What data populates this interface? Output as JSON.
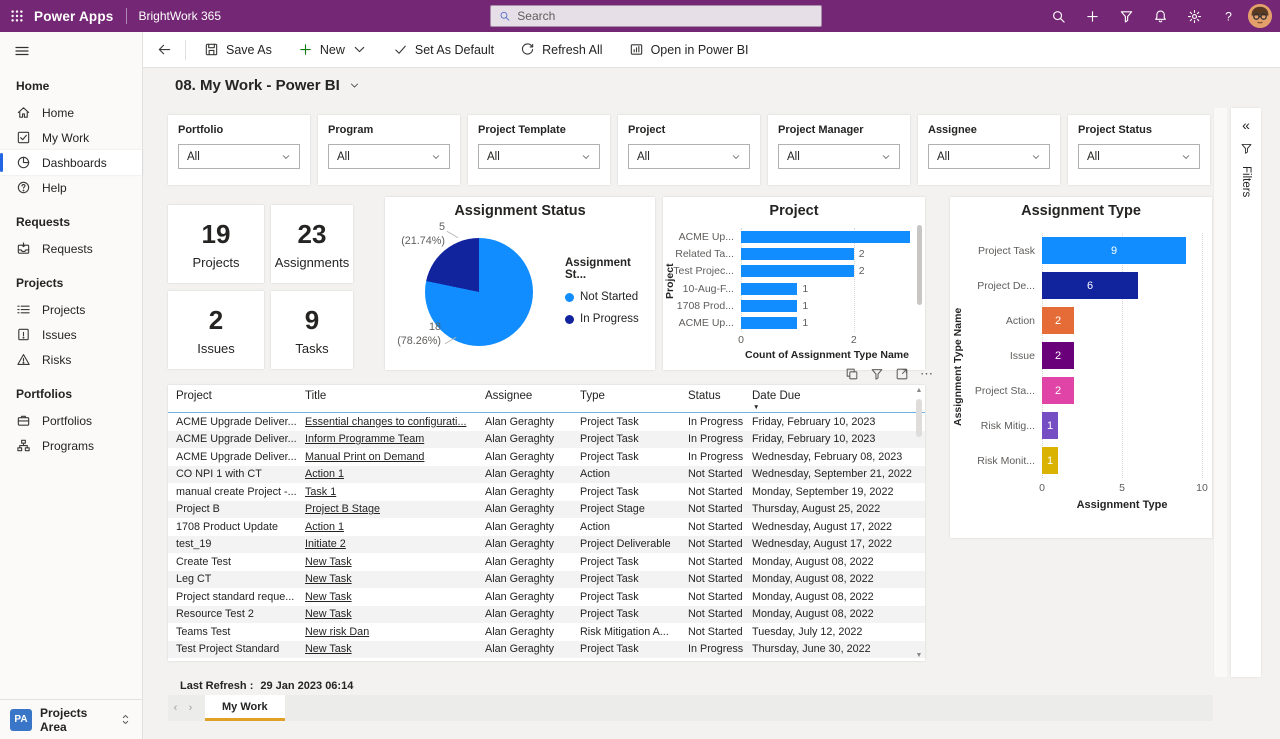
{
  "colors": {
    "header_purple": "#742774",
    "accent_blue": "#2266E3",
    "powerbi_blue": "#118DFF",
    "powerbi_navy": "#12239E",
    "tab_active_underline": "#DFA226",
    "table_header_underline": "#71AFE5"
  },
  "header": {
    "app_name": "Power Apps",
    "environment": "BrightWork 365",
    "search_placeholder": "Search",
    "icons": [
      "search",
      "add",
      "filter",
      "bell",
      "gear",
      "help"
    ]
  },
  "command_bar": {
    "items": [
      {
        "label": "Save As",
        "icon": "save",
        "dropdown": false
      },
      {
        "label": "New",
        "icon": "add-green",
        "dropdown": true
      },
      {
        "label": "Set As Default",
        "icon": "check",
        "dropdown": false
      },
      {
        "label": "Refresh All",
        "icon": "refresh",
        "dropdown": false
      },
      {
        "label": "Open in Power BI",
        "icon": "openbi",
        "dropdown": false
      }
    ]
  },
  "page": {
    "title": "08. My Work - Power BI"
  },
  "sidebar": {
    "sections": [
      {
        "heading": "Home",
        "items": [
          {
            "label": "Home",
            "icon": "home",
            "selected": false
          },
          {
            "label": "My Work",
            "icon": "mywork",
            "selected": false
          },
          {
            "label": "Dashboards",
            "icon": "dashboards",
            "selected": true
          },
          {
            "label": "Help",
            "icon": "helpdoc",
            "selected": false
          }
        ]
      },
      {
        "heading": "Requests",
        "items": [
          {
            "label": "Requests",
            "icon": "inbox",
            "selected": false
          }
        ]
      },
      {
        "heading": "Projects",
        "items": [
          {
            "label": "Projects",
            "icon": "projects",
            "selected": false
          },
          {
            "label": "Issues",
            "icon": "issues",
            "selected": false
          },
          {
            "label": "Risks",
            "icon": "risks",
            "selected": false
          }
        ]
      },
      {
        "heading": "Portfolios",
        "items": [
          {
            "label": "Portfolios",
            "icon": "briefcase",
            "selected": false
          },
          {
            "label": "Programs",
            "icon": "org",
            "selected": false
          }
        ]
      }
    ],
    "area_switcher": {
      "badge": "PA",
      "label": "Projects Area"
    }
  },
  "filters_pane": {
    "label": "Filters"
  },
  "slicers": [
    {
      "label": "Portfolio",
      "value": "All"
    },
    {
      "label": "Program",
      "value": "All"
    },
    {
      "label": "Project Template",
      "value": "All"
    },
    {
      "label": "Project",
      "value": "All"
    },
    {
      "label": "Project Manager",
      "value": "All"
    },
    {
      "label": "Assignee",
      "value": "All"
    },
    {
      "label": "Project Status",
      "value": "All"
    }
  ],
  "kpis": [
    {
      "value": "19",
      "label": "Projects"
    },
    {
      "value": "23",
      "label": "Assignments"
    },
    {
      "value": "2",
      "label": "Issues"
    },
    {
      "value": "9",
      "label": "Tasks"
    }
  ],
  "chart_data": [
    {
      "type": "pie",
      "title": "Assignment Status",
      "legend_title": "Assignment St...",
      "slices": [
        {
          "label": "Not Started",
          "value": 18,
          "pct_label": "(78.26%)",
          "color": "#118DFF"
        },
        {
          "label": "In Progress",
          "value": 5,
          "pct_label": "(21.74%)",
          "color": "#12239E"
        }
      ]
    },
    {
      "type": "bar",
      "orientation": "horizontal",
      "title": "Project",
      "ylabel": "Project",
      "xlabel": "Count of Assignment Type Name",
      "categories": [
        "ACME Up...",
        "Related Ta...",
        "Test Projec...",
        "10-Aug-F...",
        "1708 Prod...",
        "ACME Up..."
      ],
      "values": [
        3,
        2,
        2,
        1,
        1,
        1
      ],
      "data_labels": [
        "",
        "2",
        "2",
        "1",
        "1",
        "1"
      ],
      "bar_color": "#118DFF",
      "xticks": [
        0,
        2
      ],
      "xmax": 3.05,
      "scrollbar": true
    },
    {
      "type": "bar",
      "orientation": "horizontal",
      "title": "Assignment Type",
      "ylabel": "Assignment Type Name",
      "xlabel": "Assignment Type",
      "categories": [
        "Project Task",
        "Project De...",
        "Action",
        "Issue",
        "Project Sta...",
        "Risk Mitig...",
        "Risk Monit..."
      ],
      "values": [
        9,
        6,
        2,
        2,
        2,
        1,
        1
      ],
      "data_labels": [
        "9",
        "6",
        "2",
        "2",
        "2",
        "1",
        "1"
      ],
      "colors": [
        "#118DFF",
        "#12239E",
        "#E66C37",
        "#6B007B",
        "#E044A7",
        "#744EC2",
        "#D9B300"
      ],
      "xticks": [
        0,
        5,
        10
      ],
      "xmax": 10
    }
  ],
  "table": {
    "columns": [
      "Project",
      "Title",
      "Assignee",
      "Type",
      "Status",
      "Date Due"
    ],
    "sort_column": "Date Due",
    "toolbar_icons": [
      "copy",
      "filter",
      "focus",
      "more"
    ],
    "rows": [
      [
        "ACME Upgrade Deliver...",
        "Essential changes to configurati...",
        "Alan Geraghty",
        "Project Task",
        "In Progress",
        "Friday, February 10, 2023"
      ],
      [
        "ACME Upgrade Deliver...",
        "Inform Programme Team",
        "Alan Geraghty",
        "Project Task",
        "In Progress",
        "Friday, February 10, 2023"
      ],
      [
        "ACME Upgrade Deliver...",
        "Manual Print on Demand",
        "Alan Geraghty",
        "Project Task",
        "In Progress",
        "Wednesday, February 08, 2023"
      ],
      [
        "CO NPI 1 with CT",
        "Action 1",
        "Alan Geraghty",
        "Action",
        "Not Started",
        "Wednesday, September 21, 2022"
      ],
      [
        "manual create Project -...",
        "Task 1",
        "Alan Geraghty",
        "Project Task",
        "Not Started",
        "Monday, September 19, 2022"
      ],
      [
        "Project B",
        "Project B Stage",
        "Alan Geraghty",
        "Project Stage",
        "Not Started",
        "Thursday, August 25, 2022"
      ],
      [
        "1708 Product Update",
        "Action 1",
        "Alan Geraghty",
        "Action",
        "Not Started",
        "Wednesday, August 17, 2022"
      ],
      [
        "test_19",
        "Initiate 2",
        "Alan Geraghty",
        "Project Deliverable",
        "Not Started",
        "Wednesday, August 17, 2022"
      ],
      [
        "Create Test",
        "New Task",
        "Alan Geraghty",
        "Project Task",
        "Not Started",
        "Monday, August 08, 2022"
      ],
      [
        "Leg CT",
        "New Task",
        "Alan Geraghty",
        "Project Task",
        "Not Started",
        "Monday, August 08, 2022"
      ],
      [
        "Project standard reque...",
        "New Task",
        "Alan Geraghty",
        "Project Task",
        "Not Started",
        "Monday, August 08, 2022"
      ],
      [
        "Resource Test 2",
        "New Task",
        "Alan Geraghty",
        "Project Task",
        "Not Started",
        "Monday, August 08, 2022"
      ],
      [
        "Teams Test",
        "New risk Dan",
        "Alan Geraghty",
        "Risk Mitigation A...",
        "Not Started",
        "Tuesday, July 12, 2022"
      ],
      [
        "Test Project Standard",
        "New Task",
        "Alan Geraghty",
        "Project Task",
        "In Progress",
        "Thursday, June 30, 2022"
      ]
    ]
  },
  "footer": {
    "last_refresh_label": "Last Refresh :",
    "last_refresh_value": "29 Jan 2023 06:14",
    "tabs": [
      {
        "label": "My Work",
        "active": true
      }
    ]
  }
}
